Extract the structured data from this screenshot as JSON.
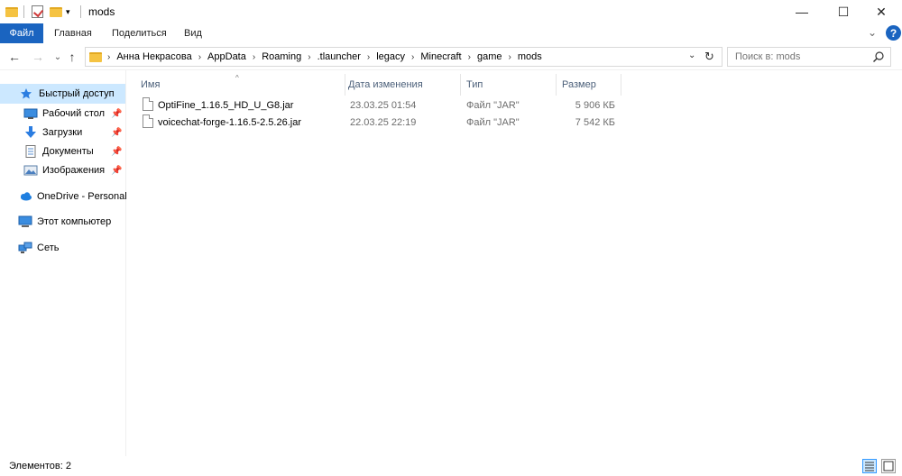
{
  "window": {
    "title": "mods",
    "minimize_glyph": "—",
    "maximize_glyph": "☐",
    "close_glyph": "✕"
  },
  "ribbon": {
    "tabs": [
      "Файл",
      "Главная",
      "Поделиться",
      "Вид"
    ],
    "collapse_glyph": "⌄",
    "help_glyph": "?"
  },
  "nav": {
    "back_glyph": "←",
    "forward_glyph": "→",
    "recent_glyph": "⌄",
    "up_glyph": "↑",
    "breadcrumb": [
      "Анна Некрасова",
      "AppData",
      "Roaming",
      ".tlauncher",
      "legacy",
      "Minecraft",
      "game",
      "mods"
    ],
    "crumb_separator": "›",
    "dropdown_glyph": "⌄",
    "refresh_glyph": "↻",
    "search_placeholder": "Поиск в: mods"
  },
  "sidebar": {
    "pin_glyph": "📌",
    "items": [
      {
        "label": "Быстрый доступ",
        "icon": "star-icon",
        "pinned": false
      },
      {
        "label": "Рабочий стол",
        "icon": "desktop-icon",
        "pinned": true
      },
      {
        "label": "Загрузки",
        "icon": "download-icon",
        "pinned": true
      },
      {
        "label": "Документы",
        "icon": "document-icon",
        "pinned": true
      },
      {
        "label": "Изображения",
        "icon": "pictures-icon",
        "pinned": true
      },
      {
        "label": "OneDrive - Personal",
        "icon": "cloud-icon",
        "pinned": false
      },
      {
        "label": "Этот компьютер",
        "icon": "computer-icon",
        "pinned": false
      },
      {
        "label": "Сеть",
        "icon": "network-icon",
        "pinned": false
      }
    ]
  },
  "files": {
    "sort_glyph": "^",
    "columns": [
      "Имя",
      "Дата изменения",
      "Тип",
      "Размер"
    ],
    "rows": [
      {
        "name": "OptiFine_1.16.5_HD_U_G8.jar",
        "date": "23.03.25 01:54",
        "type": "Файл \"JAR\"",
        "size": "5 906 КБ"
      },
      {
        "name": "voicechat-forge-1.16.5-2.5.26.jar",
        "date": "22.03.25 22:19",
        "type": "Файл \"JAR\"",
        "size": "7 542 КБ"
      }
    ]
  },
  "status": {
    "items_label": "Элементов: 2"
  },
  "colors": {
    "accent": "#1a64c0",
    "selection": "#cce8ff",
    "folder": "#f5c342"
  }
}
